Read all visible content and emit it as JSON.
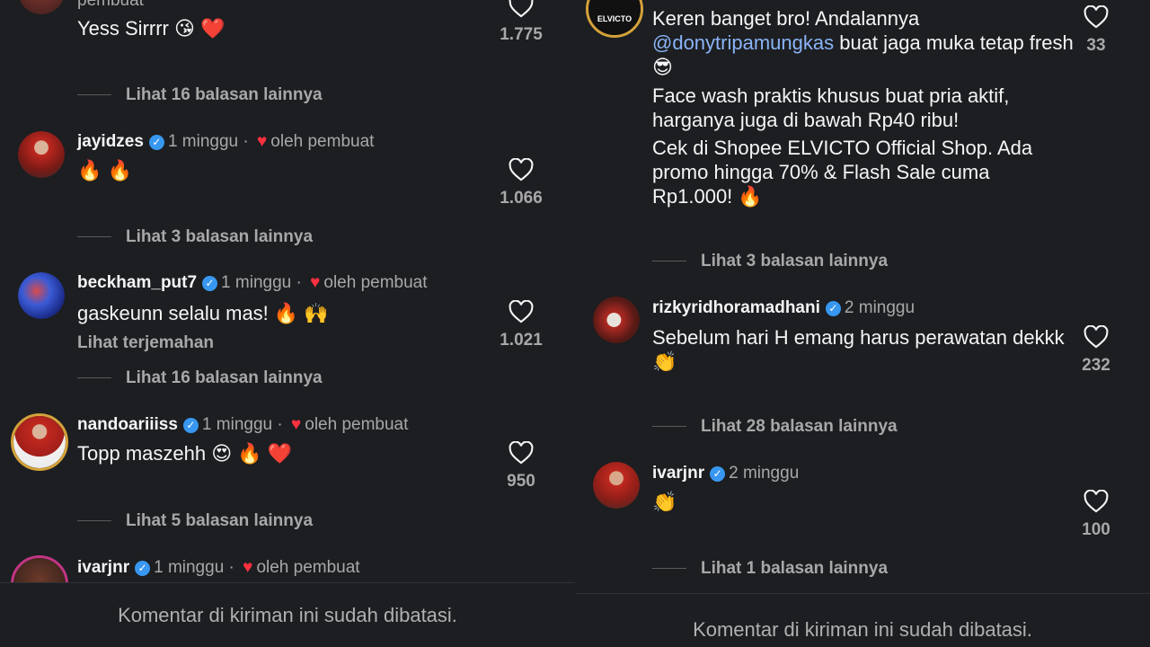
{
  "left": {
    "comments": [
      {
        "author_partial": "pembuat",
        "text": "Yess Sirrrr 😘 ❤️",
        "likes": "1.775",
        "replies": "Lihat 16 balasan lainnya"
      },
      {
        "author": "jayidzes",
        "time": "1 minggu",
        "by_creator": "oleh pembuat",
        "text": "🔥 🔥",
        "likes": "1.066",
        "replies": "Lihat 3 balasan lainnya"
      },
      {
        "author": "beckham_put7",
        "time": "1 minggu",
        "by_creator": "oleh pembuat",
        "text": "gaskeunn selalu mas! 🔥 🙌",
        "translate": "Lihat terjemahan",
        "likes": "1.021",
        "replies": "Lihat 16 balasan lainnya"
      },
      {
        "author": "nandoariiiss",
        "time": "1 minggu",
        "by_creator": "oleh pembuat",
        "text": "Topp maszehh 😍 🔥 ❤️",
        "likes": "950",
        "replies": "Lihat 5 balasan lainnya"
      },
      {
        "author": "ivarjnr",
        "time": "1 minggu",
        "by_creator": "oleh pembuat"
      }
    ],
    "footer": "Komentar di kiriman ini sudah dibatasi."
  },
  "right": {
    "comments": [
      {
        "avatar_text": "ELVICTO",
        "text_1a": "Keren banget bro! Andalannya",
        "mention": "@donytripamungkas",
        "text_1b": " buat jaga muka tetap fresh😎",
        "text_2": "Face wash praktis khusus buat pria aktif, harganya juga di bawah Rp40 ribu!",
        "text_3": "Cek di Shopee ELVICTO Official Shop. Ada promo hingga 70% & Flash Sale cuma Rp1.000! 🔥",
        "likes": "33",
        "replies": "Lihat 3 balasan lainnya"
      },
      {
        "author": "rizkyridhoramadhani",
        "time": "2 minggu",
        "text": "Sebelum hari H emang harus perawatan dekkk 👏",
        "likes": "232",
        "replies": "Lihat 28 balasan lainnya"
      },
      {
        "author": "ivarjnr",
        "time": "2 minggu",
        "text": "👏",
        "likes": "100",
        "replies": "Lihat 1 balasan lainnya"
      }
    ],
    "footer": "Komentar di kiriman ini sudah dibatasi."
  },
  "icons": {
    "like": "heart-outline-icon",
    "verified": "verified-badge-icon",
    "creator_like": "heart-filled-icon"
  },
  "colors": {
    "background": "#1c1e21",
    "verified": "#3897f0",
    "heart": "#ff3040",
    "mention": "#8ab4f8"
  }
}
